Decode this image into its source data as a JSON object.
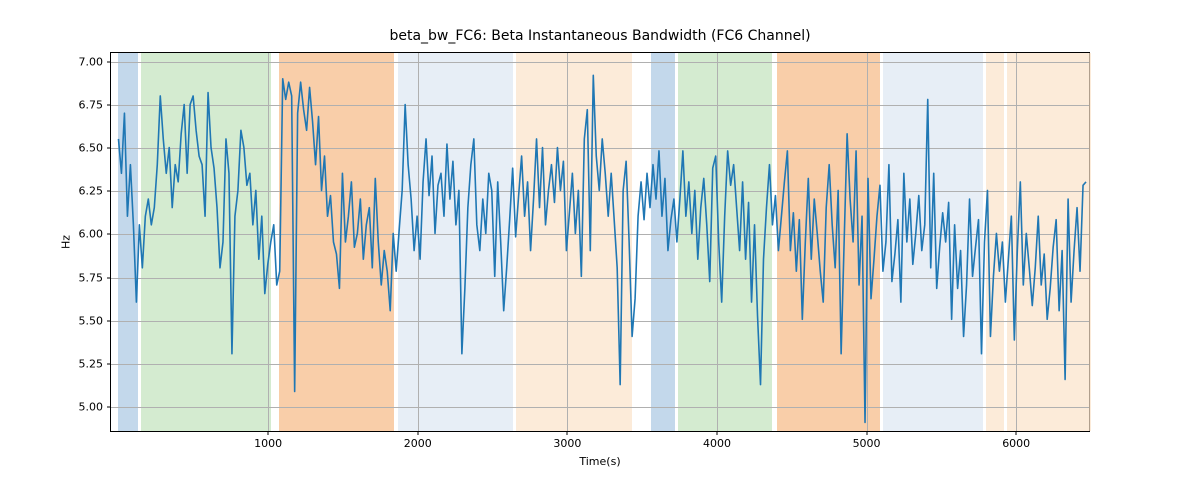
{
  "chart_data": {
    "type": "line",
    "title": "beta_bw_FC6: Beta Instantaneous Bandwidth (FC6 Channel)",
    "xlabel": "Time(s)",
    "ylabel": "Hz",
    "xlim": [
      -50,
      6500
    ],
    "ylim": [
      4.85,
      7.05
    ],
    "xticks": [
      1000,
      2000,
      3000,
      4000,
      5000,
      6000
    ],
    "yticks": [
      5.0,
      5.25,
      5.5,
      5.75,
      6.0,
      6.25,
      6.5,
      6.75,
      7.0
    ],
    "bands": [
      {
        "x0": 0,
        "x1": 130,
        "color": "#9bbedd",
        "alpha": 0.6
      },
      {
        "x0": 150,
        "x1": 1020,
        "color": "#b7ddb0",
        "alpha": 0.6
      },
      {
        "x0": 1070,
        "x1": 1840,
        "color": "#f6b37b",
        "alpha": 0.65
      },
      {
        "x0": 1870,
        "x1": 2640,
        "color": "#dde7f2",
        "alpha": 0.7
      },
      {
        "x0": 2660,
        "x1": 3430,
        "color": "#fbe3c9",
        "alpha": 0.7
      },
      {
        "x0": 3560,
        "x1": 3720,
        "color": "#9bbedd",
        "alpha": 0.6
      },
      {
        "x0": 3740,
        "x1": 4370,
        "color": "#b7ddb0",
        "alpha": 0.6
      },
      {
        "x0": 4400,
        "x1": 5090,
        "color": "#f6b37b",
        "alpha": 0.65
      },
      {
        "x0": 5110,
        "x1": 5780,
        "color": "#dde7f2",
        "alpha": 0.7
      },
      {
        "x0": 5800,
        "x1": 5920,
        "color": "#fbe3c9",
        "alpha": 0.7
      },
      {
        "x0": 5940,
        "x1": 6500,
        "color": "#fbe3c9",
        "alpha": 0.7
      }
    ],
    "series": [
      {
        "name": "beta_bw_FC6",
        "color": "#1f77b4",
        "x_step": 20,
        "x_start": 0,
        "values": [
          6.55,
          6.35,
          6.7,
          6.1,
          6.4,
          6.05,
          5.6,
          6.05,
          5.8,
          6.1,
          6.2,
          6.05,
          6.15,
          6.4,
          6.8,
          6.55,
          6.35,
          6.5,
          6.15,
          6.4,
          6.3,
          6.58,
          6.75,
          6.35,
          6.75,
          6.8,
          6.6,
          6.45,
          6.4,
          6.1,
          6.82,
          6.5,
          6.38,
          6.15,
          5.8,
          5.95,
          6.55,
          6.35,
          5.3,
          6.1,
          6.25,
          6.6,
          6.5,
          6.28,
          6.35,
          6.05,
          6.25,
          5.85,
          6.1,
          5.65,
          5.82,
          5.95,
          6.05,
          5.7,
          5.78,
          6.9,
          6.78,
          6.88,
          6.8,
          5.08,
          6.7,
          6.88,
          6.72,
          6.6,
          6.85,
          6.65,
          6.4,
          6.68,
          6.25,
          6.45,
          6.1,
          6.22,
          5.95,
          5.88,
          5.68,
          6.35,
          5.95,
          6.1,
          6.3,
          5.92,
          6.0,
          6.2,
          5.85,
          6.05,
          6.15,
          5.8,
          6.32,
          5.95,
          5.7,
          5.9,
          5.78,
          5.55,
          6.0,
          5.78,
          6.02,
          6.25,
          6.75,
          6.4,
          6.2,
          5.9,
          6.1,
          5.85,
          6.3,
          6.55,
          6.22,
          6.45,
          6.0,
          6.28,
          6.35,
          6.1,
          6.52,
          6.2,
          6.42,
          6.05,
          6.25,
          5.3,
          5.68,
          6.15,
          6.4,
          6.55,
          6.05,
          5.9,
          6.2,
          6.0,
          6.35,
          6.25,
          5.75,
          6.3,
          5.95,
          5.55,
          5.8,
          6.08,
          6.38,
          5.98,
          6.22,
          6.45,
          6.1,
          6.3,
          5.9,
          6.2,
          6.55,
          6.15,
          6.5,
          6.05,
          6.25,
          6.4,
          6.18,
          6.5,
          6.25,
          6.42,
          5.9,
          6.12,
          6.35,
          6.0,
          6.25,
          5.75,
          6.55,
          6.72,
          5.9,
          6.92,
          6.45,
          6.25,
          6.55,
          6.35,
          6.1,
          6.35,
          6.08,
          5.8,
          5.12,
          6.25,
          6.42,
          5.95,
          5.4,
          5.62,
          6.1,
          6.3,
          6.08,
          6.35,
          6.15,
          6.4,
          6.2,
          6.48,
          6.1,
          6.32,
          5.9,
          6.08,
          6.2,
          5.95,
          6.2,
          6.48,
          6.1,
          6.3,
          6.0,
          6.25,
          5.85,
          6.15,
          6.32,
          6.05,
          5.72,
          6.38,
          6.45,
          5.95,
          5.6,
          6.1,
          6.48,
          6.28,
          6.4,
          6.15,
          5.9,
          6.3,
          5.85,
          6.18,
          5.6,
          6.05,
          5.52,
          5.12,
          5.85,
          6.15,
          6.4,
          6.05,
          6.22,
          5.9,
          6.1,
          6.3,
          6.48,
          5.9,
          6.12,
          5.78,
          6.08,
          5.5,
          5.95,
          6.32,
          5.85,
          6.2,
          6.0,
          5.78,
          5.6,
          6.15,
          6.4,
          6.05,
          5.8,
          6.25,
          5.3,
          5.95,
          6.58,
          6.2,
          5.95,
          6.48,
          5.7,
          6.1,
          4.9,
          6.32,
          5.62,
          5.85,
          6.1,
          6.28,
          5.78,
          5.95,
          6.4,
          5.72,
          5.88,
          6.08,
          5.6,
          6.35,
          5.95,
          6.2,
          5.82,
          6.0,
          6.22,
          5.9,
          6.05,
          6.78,
          5.8,
          6.35,
          5.68,
          5.92,
          6.12,
          5.95,
          6.18,
          5.5,
          6.05,
          5.68,
          5.9,
          5.4,
          5.7,
          6.2,
          5.75,
          5.92,
          6.08,
          5.3,
          5.95,
          6.25,
          5.4,
          5.75,
          6.0,
          5.78,
          5.95,
          5.6,
          5.85,
          6.1,
          5.38,
          5.9,
          6.3,
          5.7,
          6.0,
          5.8,
          5.58,
          5.8,
          6.1,
          5.7,
          5.88,
          5.5,
          5.68,
          5.92,
          6.08,
          5.55,
          5.9,
          5.15,
          6.2,
          5.6,
          5.9,
          6.15,
          5.78,
          6.28,
          6.3
        ]
      }
    ]
  }
}
